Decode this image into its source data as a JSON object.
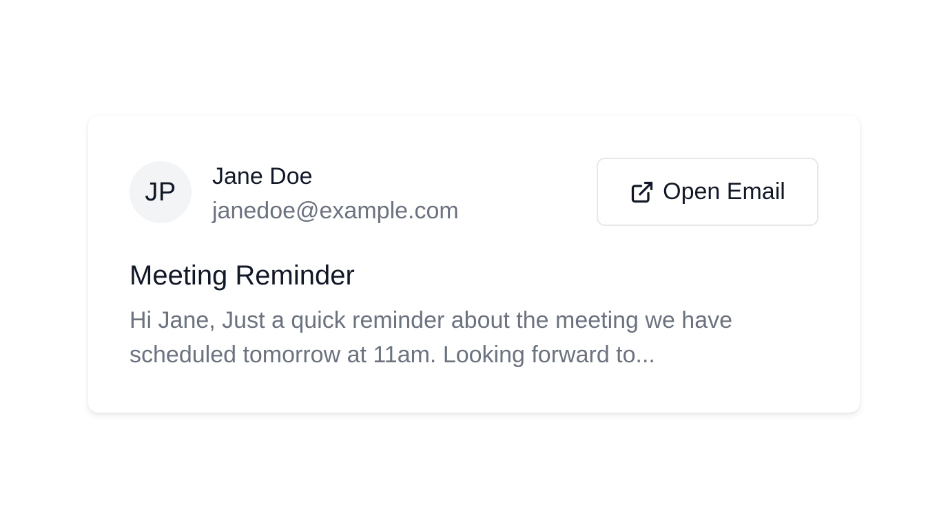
{
  "sender": {
    "initials": "JP",
    "name": "Jane Doe",
    "email": "janedoe@example.com"
  },
  "actions": {
    "open_email_label": "Open Email",
    "open_email_icon": "external-link-icon"
  },
  "message": {
    "subject": "Meeting Reminder",
    "preview": "Hi Jane, Just a quick reminder about the meeting we have scheduled tomorrow at 11am. Looking forward to..."
  },
  "colors": {
    "primary_text": "#111827",
    "secondary_text": "#6b7280",
    "avatar_bg": "#f3f4f6",
    "button_border": "#e5e7eb"
  }
}
